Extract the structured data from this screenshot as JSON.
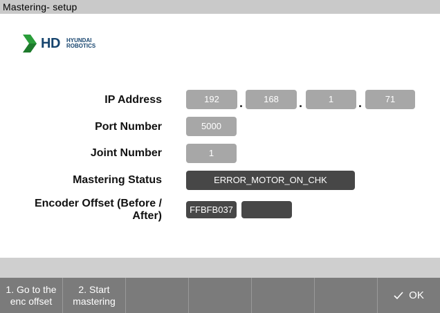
{
  "window": {
    "title": "Mastering- setup"
  },
  "logo": {
    "brand": "HD",
    "line1": "HYUNDAI",
    "line2": "ROBOTICS"
  },
  "form": {
    "ip_label": "IP Address",
    "ip": [
      "192",
      "168",
      "1",
      "71"
    ],
    "ip_separator": ".",
    "port_label": "Port Number",
    "port": "5000",
    "joint_label": "Joint Number",
    "joint": "1",
    "status_label": "Mastering Status",
    "status": "ERROR_MOTOR_ON_CHK",
    "encoder_label_line1": "Encoder Offset (Before /",
    "encoder_label_line2": "After)",
    "encoder_before": "FFBFB037",
    "encoder_after": ""
  },
  "footer": {
    "buttons": [
      {
        "line1": "1. Go to the",
        "line2": "enc offset"
      },
      {
        "line1": "2. Start",
        "line2": "mastering"
      }
    ],
    "ok_label": "OK"
  },
  "colors": {
    "field_light": "#a7a7a7",
    "field_dark": "#474747",
    "footer": "#7b7b7b",
    "brand_navy": "#16446e",
    "brand_green": "#2a9d3a"
  }
}
